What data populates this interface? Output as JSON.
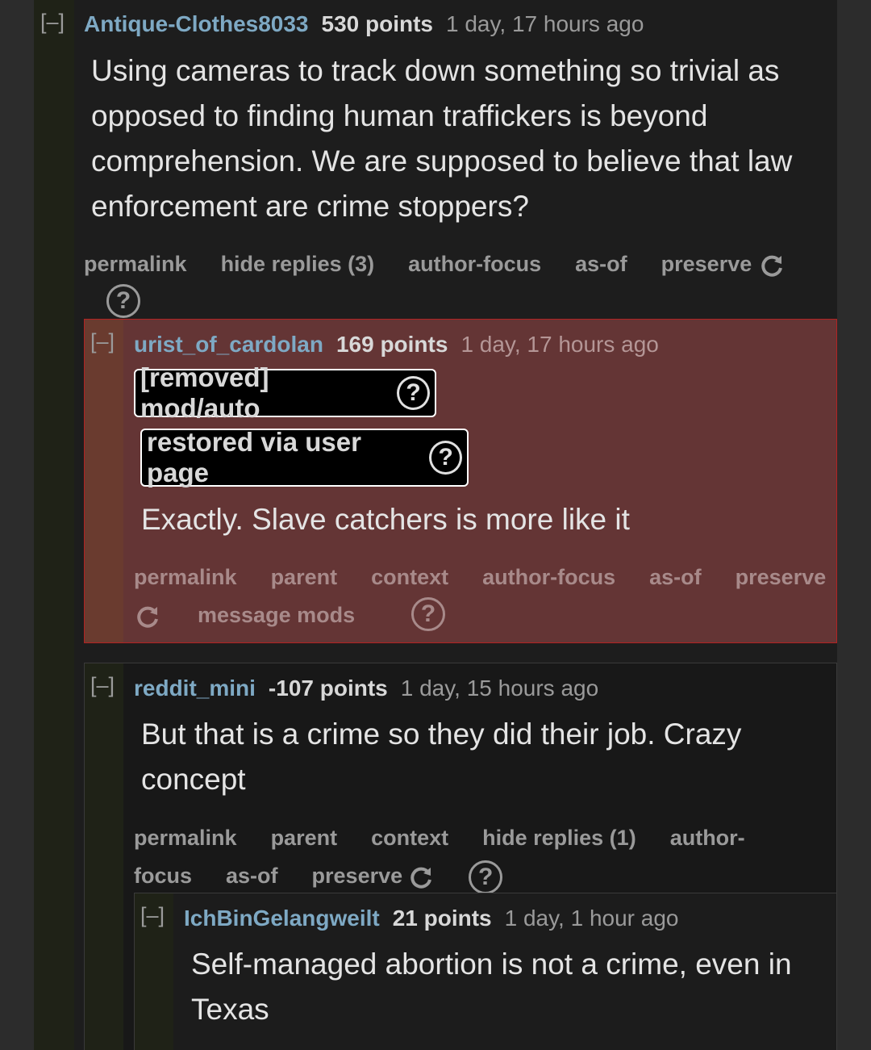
{
  "comments": [
    {
      "collapse": "[–]",
      "author": "Antique-Clothes8033",
      "points": "530 points",
      "time": "1 day, 17 hours ago",
      "body": [
        "Using cameras to track down something so trivial as",
        "opposed to finding human traffickers is beyond",
        "comprehension. We are supposed to believe that law",
        "enforcement are crime stoppers?"
      ],
      "links": [
        "permalink",
        "hide replies (3)",
        "author-focus",
        "as-of",
        "preserve"
      ]
    },
    {
      "collapse": "[–]",
      "author": "urist_of_cardolan",
      "points": "169 points",
      "time": "1 day, 17 hours ago",
      "badge_removed": "[removed] mod/auto",
      "badge_restored": "restored via user page",
      "body": [
        "Exactly. Slave catchers is more like it"
      ],
      "links": [
        "permalink",
        "parent",
        "context",
        "author-focus",
        "as-of",
        "preserve"
      ],
      "message_mods": "message mods"
    },
    {
      "collapse": "[–]",
      "author": "reddit_mini",
      "points": "-107 points",
      "time": "1 day, 15 hours ago",
      "body": [
        "But that is a crime so they did their job. Crazy",
        "concept"
      ],
      "links": [
        "permalink",
        "parent",
        "context",
        "hide replies (1)",
        "author-"
      ],
      "links2": [
        "focus",
        "as-of",
        "preserve"
      ]
    },
    {
      "collapse": "[–]",
      "author": "IchBinGelangweilt",
      "points": "21 points",
      "time": "1 day, 1 hour ago",
      "body": [
        "Self-managed abortion is not a crime, even in",
        "Texas"
      ]
    }
  ],
  "icons": {
    "help": "?"
  }
}
